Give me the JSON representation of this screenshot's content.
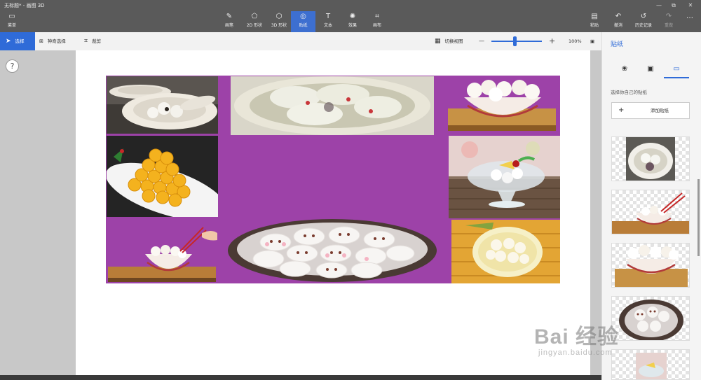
{
  "window": {
    "title": "无标题* - 画图 3D",
    "controls": [
      "—",
      "⧉",
      "✕"
    ]
  },
  "toolbar": {
    "menu": {
      "label": "菜单",
      "icon": "folder-icon"
    },
    "tools": [
      {
        "label": "画笔",
        "icon": "brush-icon"
      },
      {
        "label": "2D 形状",
        "icon": "2d-shapes-icon"
      },
      {
        "label": "3D 形状",
        "icon": "3d-shapes-icon"
      },
      {
        "label": "贴纸",
        "icon": "sticker-icon",
        "active": true
      },
      {
        "label": "文本",
        "icon": "text-icon"
      },
      {
        "label": "效果",
        "icon": "effects-icon"
      },
      {
        "label": "画布",
        "icon": "canvas-icon"
      }
    ],
    "right": [
      {
        "label": "粘贴",
        "icon": "paste-icon"
      },
      {
        "label": "撤消",
        "icon": "undo-icon"
      },
      {
        "label": "历史记录",
        "icon": "history-icon"
      },
      {
        "label": "重做",
        "icon": "redo-icon"
      },
      {
        "label": "…",
        "icon": "more-icon"
      }
    ]
  },
  "subbar": {
    "select": "选择",
    "magic_select": "神奇选择",
    "crop": "裁剪",
    "switch_view": "切换视图",
    "zoom_minus": "—",
    "zoom_plus": "+",
    "zoom_level": "100%",
    "zoom_fraction": 0.47
  },
  "help": "?",
  "panel": {
    "title": "贴纸",
    "tabs": [
      "palette-icon",
      "layers-icon",
      "folder-icon"
    ],
    "active_tab": 2,
    "subtitle": "选择你自己的贴纸",
    "add_button": "添加贴纸",
    "add_plus": "+"
  },
  "watermark": {
    "brand": "Bai 经验",
    "sub": "jingyan.baidu.com"
  },
  "colors": {
    "accent": "#2f6bd8",
    "composition_bg": "#9d42a8",
    "toolbar_bg": "#5a5a5a"
  }
}
